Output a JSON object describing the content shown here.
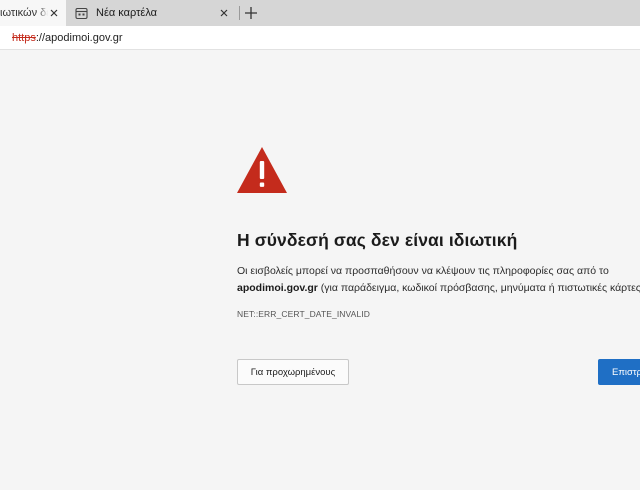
{
  "tabs": [
    {
      "label": "ιωτικών δε",
      "active": true
    },
    {
      "label": "Νέα καρτέλα",
      "active": false
    }
  ],
  "address": {
    "scheme": "https",
    "separator": "://",
    "host": "apodimoi.gov.gr"
  },
  "error_page": {
    "heading": "Η σύνδεσή σας δεν είναι ιδιωτική",
    "description_line1": "Οι εισβολείς μπορεί να προσπαθήσουν να κλέψουν τις πληροφορίες σας από το",
    "description_host": "apodimoi.gov.gr",
    "description_line2_rest": " (για παράδειγμα, κωδικοί πρόσβασης, μηνύματα ή πιστωτικές κάρτες)",
    "error_code": "NET::ERR_CERT_DATE_INVALID",
    "advanced_button": "Για προχωρημένους",
    "back_button": "Επιστρ"
  },
  "colors": {
    "warning_red": "#c42b1c",
    "primary_button": "#1f6fc5",
    "background": "#f5f5f5"
  },
  "icons": {
    "warning": "warning-triangle-icon",
    "new_tab_page": "new-tab-page-icon",
    "close": "close-icon",
    "add": "plus-icon"
  }
}
